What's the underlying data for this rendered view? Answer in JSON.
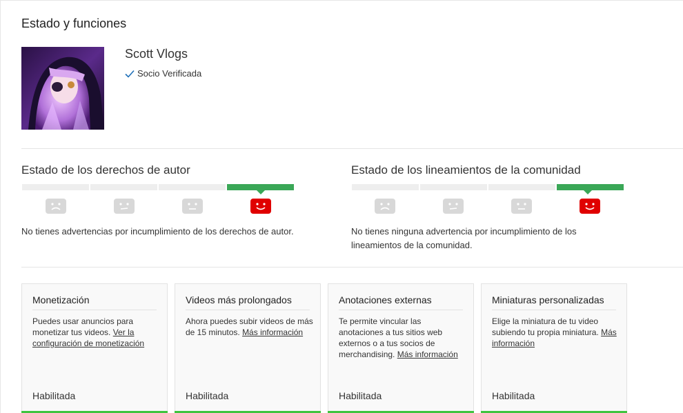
{
  "page": {
    "title": "Estado y funciones"
  },
  "channel": {
    "name": "Scott Vlogs",
    "verified_label": "Socio Verificada"
  },
  "copyright": {
    "title": "Estado de los derechos de autor",
    "active_segment": 4,
    "segments": 4,
    "text": "No tienes advertencias por incumplimiento de los derechos de autor."
  },
  "community": {
    "title": "Estado de los lineamientos de la comunidad",
    "active_segment": 4,
    "segments": 4,
    "text_line1": "No tienes ninguna advertencia por incumplimiento de los",
    "text_line2": "lineamientos de la comunidad."
  },
  "colors": {
    "active_green": "#3aa757",
    "card_green": "#3ec43e",
    "face_red": "#e00000",
    "face_gray": "#d8d8d8"
  },
  "features": [
    {
      "title": "Monetización",
      "desc": "Puedes usar anuncios para monetizar tus videos. ",
      "link": "Ver la configuración de monetización",
      "status": "Habilitada"
    },
    {
      "title": "Videos más prolongados",
      "desc": "Ahora puedes subir videos de más de 15 minutos. ",
      "link": "Más información",
      "status": "Habilitada"
    },
    {
      "title": "Anotaciones externas",
      "desc": "Te permite vincular las anotaciones a tus sitios web externos o a tus socios de merchandising. ",
      "link": "Más información",
      "status": "Habilitada"
    },
    {
      "title": "Miniaturas personalizadas",
      "desc": "Elige la miniatura de tu video subiendo tu propia miniatura. ",
      "link": "Más información",
      "status": "Habilitada"
    }
  ]
}
